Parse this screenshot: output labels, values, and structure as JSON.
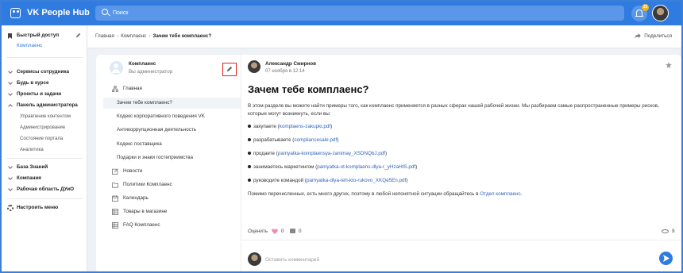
{
  "app": {
    "title": "VK People Hub"
  },
  "search": {
    "placeholder": "Поиск"
  },
  "notifications": {
    "count": "15"
  },
  "sidebar": {
    "quick_access": {
      "label": "Быстрый доступ",
      "items": [
        "Комплаенс"
      ]
    },
    "sections": [
      {
        "label": "Сервисы сотрудника",
        "expanded": false
      },
      {
        "label": "Будь в курсе",
        "expanded": false
      },
      {
        "label": "Проекты и задачи",
        "expanded": false
      },
      {
        "label": "Панель администратора",
        "expanded": true,
        "items": [
          "Управление контентом",
          "Администрирование",
          "Состояние портала",
          "Аналитика"
        ]
      },
      {
        "label": "База Знаний",
        "expanded": false
      },
      {
        "label": "Компания",
        "expanded": false
      },
      {
        "label": "Рабочая область ДУиО",
        "expanded": false
      }
    ],
    "settings_label": "Настроить меню"
  },
  "breadcrumb": {
    "items": [
      "Главная",
      "Комплаенс",
      "Зачем тебе комплаенс?"
    ],
    "share_label": "Поделиться"
  },
  "space": {
    "name": "Комплаенс",
    "role": "Вы администратор",
    "nav": [
      {
        "label": "Главная",
        "icon": "sitemap-icon",
        "level": 0
      },
      {
        "label": "Зачем тебе комплаенс?",
        "level": 1,
        "active": true
      },
      {
        "label": "Кодекс корпоративного поведения VK",
        "level": 1
      },
      {
        "label": "Антикоррупционная деятельность",
        "level": 1
      },
      {
        "label": "Кодекс поставщика",
        "level": 1
      },
      {
        "label": "Подарки и знаки гостеприимства",
        "level": 1
      },
      {
        "label": "Новости",
        "icon": "edit-square-icon",
        "level": 0
      },
      {
        "label": "Политики Комплаенс",
        "icon": "folder-icon",
        "level": 0
      },
      {
        "label": "Календарь",
        "icon": "calendar-icon",
        "level": 0
      },
      {
        "label": "Товары в магазине",
        "icon": "grid-icon",
        "level": 0
      },
      {
        "label": "FAQ Комплаенс",
        "icon": "grid-icon",
        "level": 0
      }
    ]
  },
  "post": {
    "author": "Александр Смирнов",
    "date": "07 ноября в 12:14",
    "title": "Зачем тебе комплаенс?",
    "intro": "В этом разделе вы можете найти примеры того, как комплаенс применяется в разных сферах нашей рабочей жизни. Мы разбираем самые распространенные примеры рисков, которые могут возникнуть, если вы:",
    "bullets": [
      {
        "text": "закупаете",
        "link": "komplaens-zakupki.pdf"
      },
      {
        "text": "разрабатываете",
        "link": "compliancesale.pdf"
      },
      {
        "text": "продаете",
        "link": "pamyatka-komplaensya-zanimay_XSDNQbJ.pdf"
      },
      {
        "text": "занимаетесь маркетингом",
        "link": "pamyatka-ot-komplaens-dlya-r_yHzaHtS.pdf"
      },
      {
        "text": "руководите командой",
        "link": "pamyatka-dlya-teh-kto-rukovo_XKQe5En.pdf"
      }
    ],
    "outro_text": "Помимо перечисленных, есть много других, поэтому в любой непонятной ситуации обращайтесь в",
    "outro_link": "Отдел комплаенс",
    "outro_end": ".",
    "rate_label": "Оценить",
    "likes": "0",
    "comments": "0",
    "views": "9",
    "comment_placeholder": "Оставить комментарий"
  },
  "colors": {
    "brand": "#2f7be0",
    "link": "#2f64b9",
    "highlight_border": "#e02020"
  }
}
